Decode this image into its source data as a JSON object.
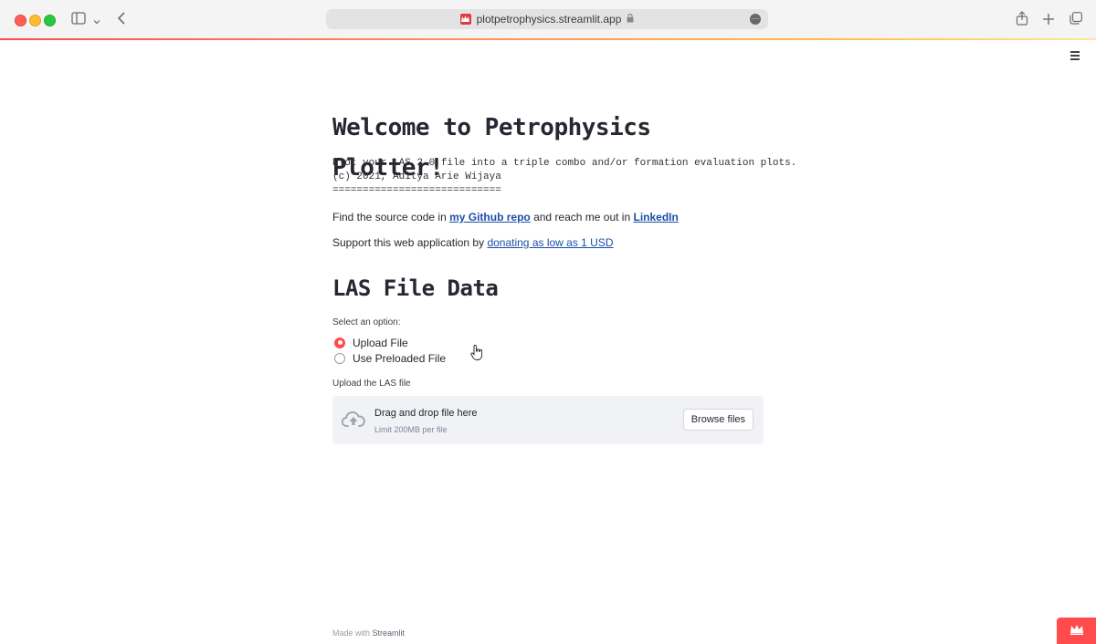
{
  "browser": {
    "url": "plotpetrophysics.streamlit.app",
    "icons": [
      "sidebar-icon",
      "chevron-down-icon",
      "back-icon",
      "share-icon",
      "new-tab-icon",
      "tabs-icon",
      "lock-icon",
      "more-icon"
    ]
  },
  "page": {
    "title": "Welcome to Petrophysics Plotter!",
    "code_lines": [
      "Plot your LAS 2.0 file into a triple combo and/or formation evaluation plots.",
      "(c) 2021, Aditya Arie Wijaya",
      "============================"
    ],
    "source": {
      "prefix": "Find the source code in ",
      "github_link": "my Github repo",
      "middle": " and reach me out in ",
      "linkedin_link": "LinkedIn"
    },
    "support": {
      "prefix": "Support this web application by ",
      "donate_link": "donating as low as 1 USD"
    },
    "section_title": "LAS File Data",
    "select_label": "Select an option:",
    "options": [
      {
        "label": "Upload File",
        "selected": true
      },
      {
        "label": "Use Preloaded File",
        "selected": false
      }
    ],
    "upload_label": "Upload the LAS file",
    "uploader": {
      "drop_text": "Drag and drop file here",
      "limit_text": "Limit 200MB per file",
      "browse_label": "Browse files"
    }
  },
  "footer": {
    "made_with": "Made with ",
    "brand": "Streamlit"
  },
  "colors": {
    "accent": "#ff4b4b",
    "link": "#1c4fa6",
    "uploader_bg": "#f0f2f6",
    "text": "#262730"
  }
}
